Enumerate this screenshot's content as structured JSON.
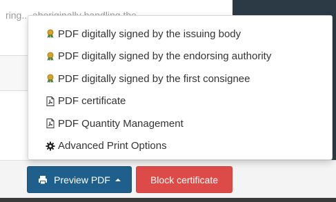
{
  "background": {
    "partial_text": "ring... aboriginally handling the..."
  },
  "menu": {
    "items": [
      {
        "label": "PDF digitally signed by the issuing body",
        "icon": "award-icon"
      },
      {
        "label": "PDF digitally signed by the endorsing authority",
        "icon": "award-icon"
      },
      {
        "label": "PDF digitally signed by the first consignee",
        "icon": "award-icon"
      },
      {
        "label": "PDF certificate",
        "icon": "file-pdf-icon"
      },
      {
        "label": "PDF Quantity Management",
        "icon": "file-pdf-icon"
      },
      {
        "label": "Advanced Print Options",
        "icon": "gear-icon"
      }
    ]
  },
  "footer": {
    "preview_label": "Preview PDF",
    "block_label": "Block certificate"
  },
  "colors": {
    "primary_button": "#1f5f8b",
    "danger_button": "#dd4b48",
    "award_icon": "#d9a521"
  }
}
